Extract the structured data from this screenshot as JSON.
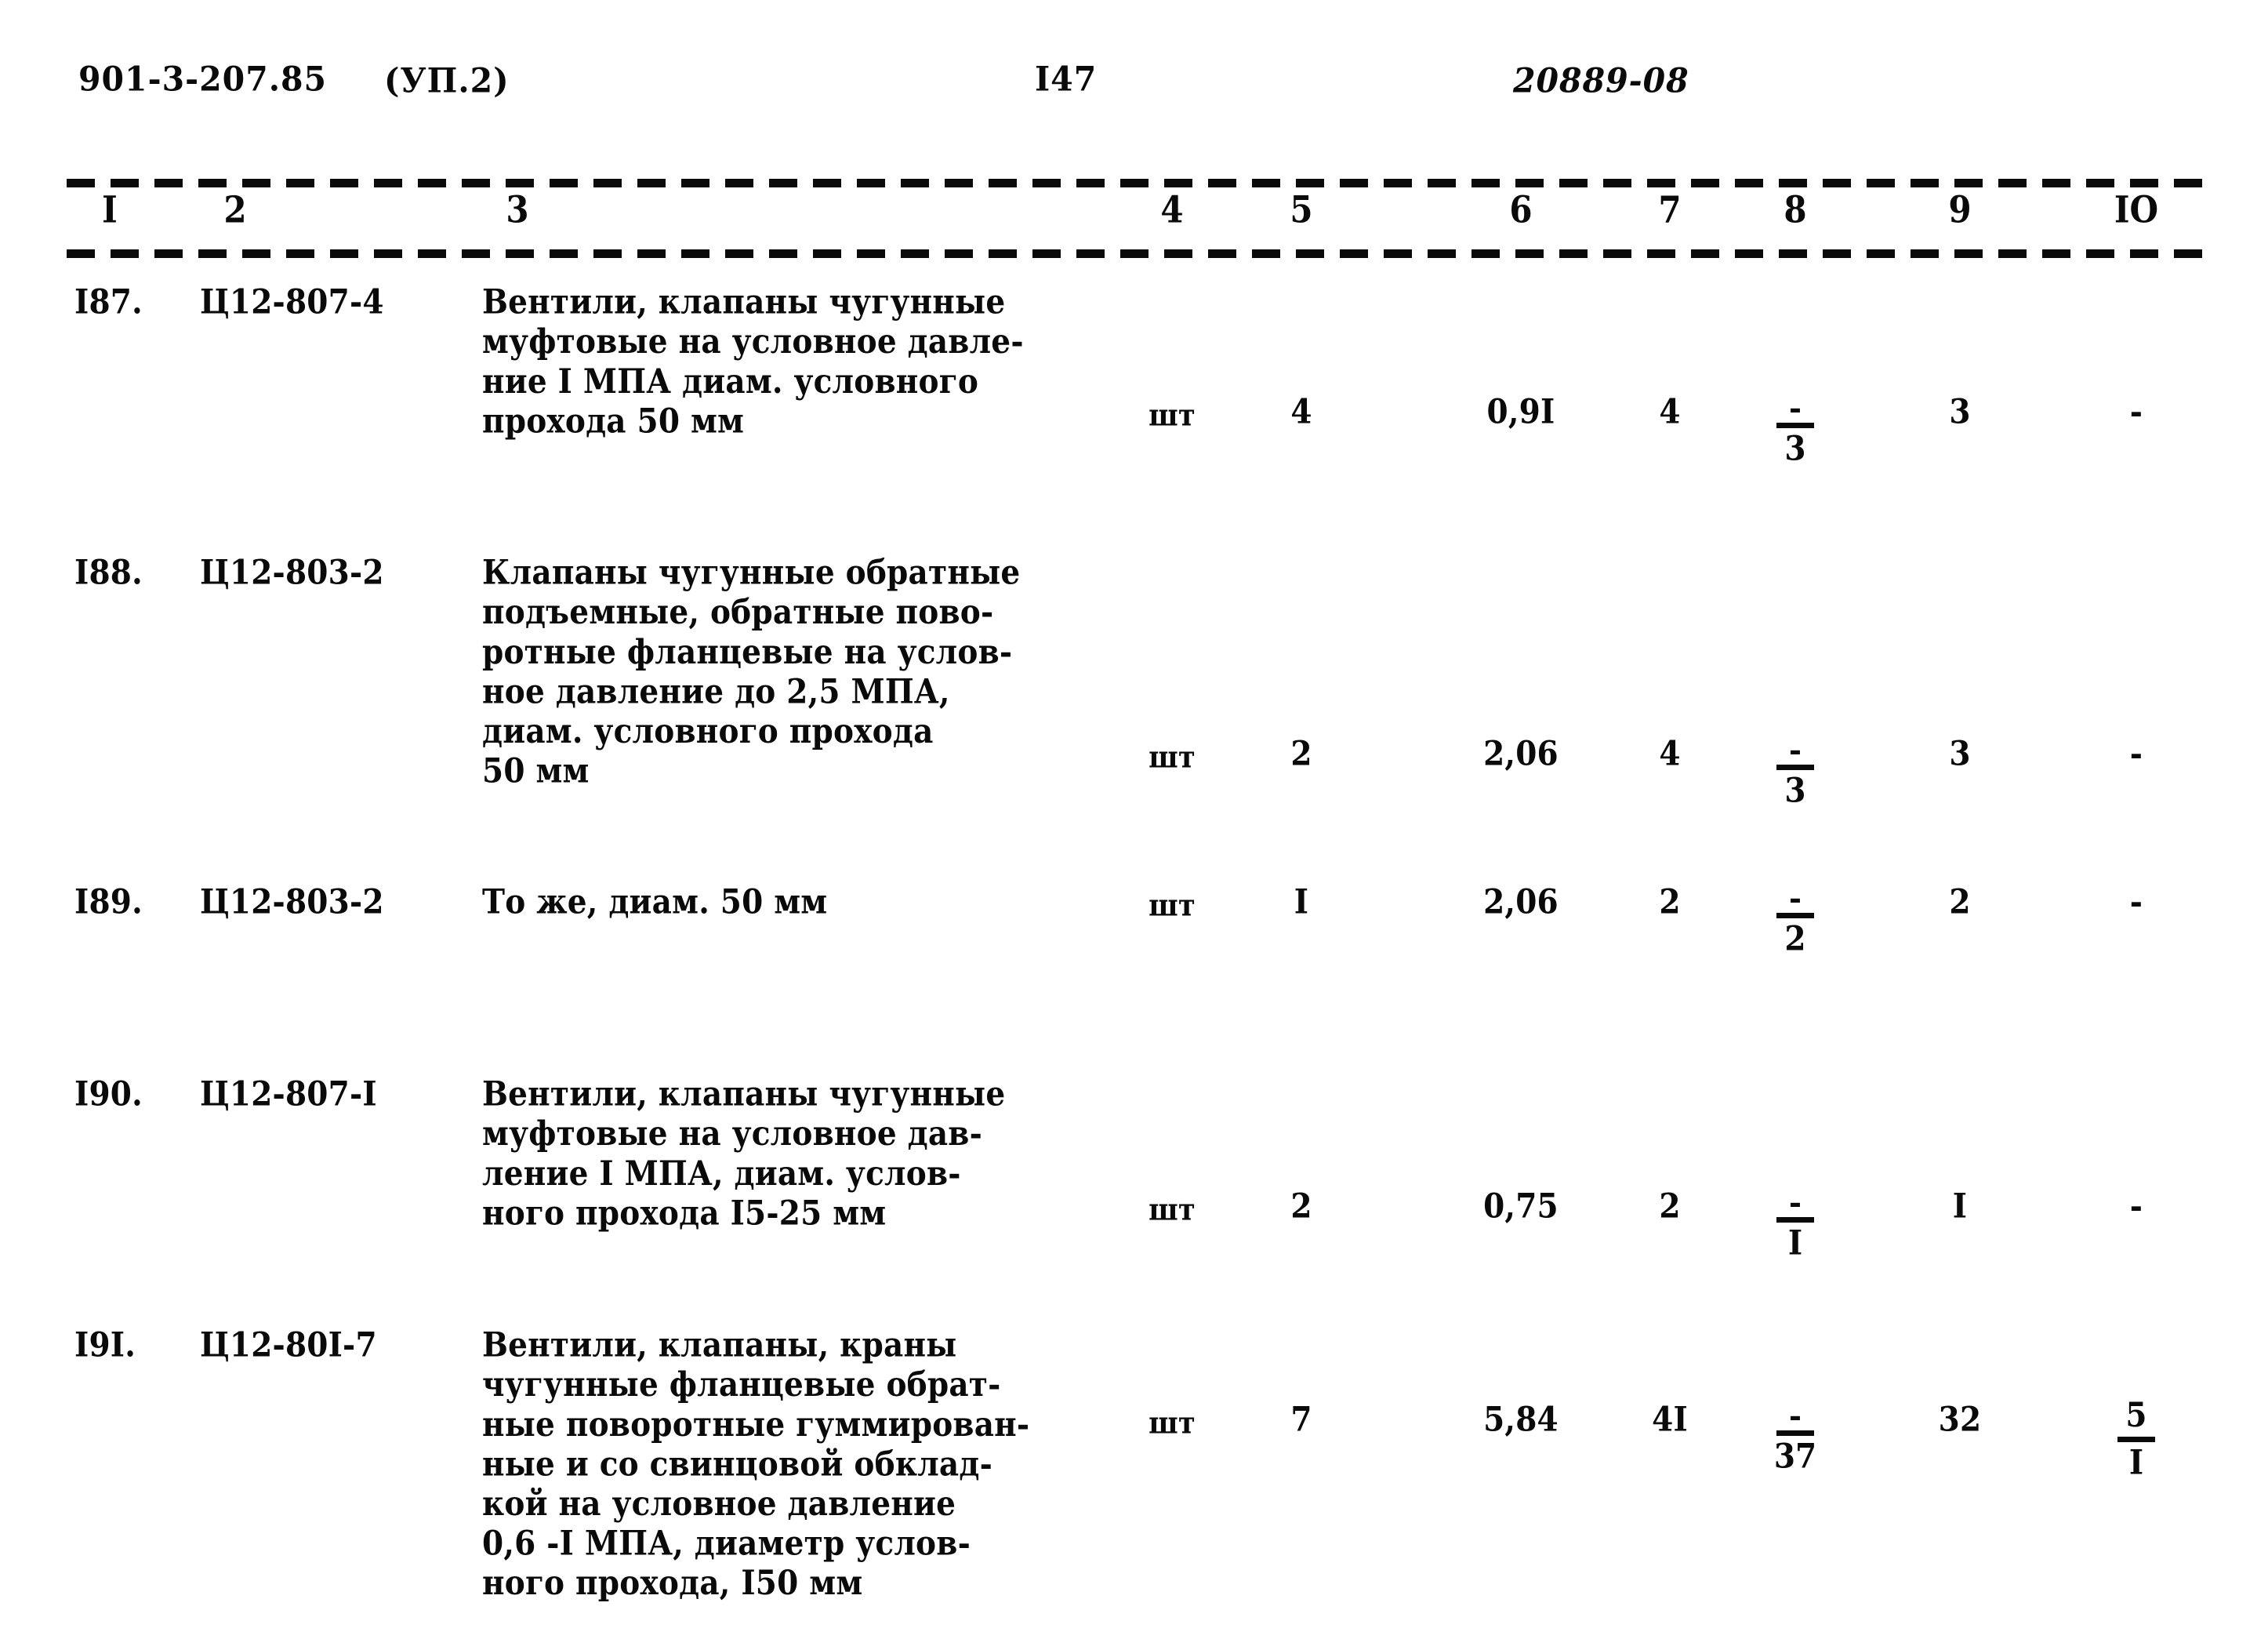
{
  "header": {
    "series_code": "901-3-207.85",
    "album": "(УП.2)",
    "page_number": "I47",
    "right_code": "20889-08"
  },
  "table": {
    "column_numbers": [
      "I",
      "2",
      "3",
      "4",
      "5",
      "6",
      "7",
      "8",
      "9",
      "IO"
    ],
    "rows": [
      {
        "num": "I87.",
        "code": "Ц12-807-4",
        "description": "Вентили, клапаны чугунные\nмуфтовые на условное давле-\nние I МПА диам. условного\nпрохода 50 мм",
        "unit": "шт",
        "col5": "4",
        "col6": "0,9I",
        "col7": "4",
        "col8_numerator": "-",
        "col8_denominator": "3",
        "col9": "3",
        "col10": "-"
      },
      {
        "num": "I88.",
        "code": "Ц12-803-2",
        "description": "Клапаны чугунные обратные\nподъемные, обратные пово-\nротные фланцевые на услов-\nное давление до 2,5 МПА,\nдиам. условного прохода\n50 мм",
        "unit": "шт",
        "col5": "2",
        "col6": "2,06",
        "col7": "4",
        "col8_numerator": "-",
        "col8_denominator": "3",
        "col9": "3",
        "col10": "-"
      },
      {
        "num": "I89.",
        "code": "Ц12-803-2",
        "description": "То же, диам. 50 мм",
        "unit": "шт",
        "col5": "I",
        "col6": "2,06",
        "col7": "2",
        "col8_numerator": "-",
        "col8_denominator": "2",
        "col9": "2",
        "col10": "-"
      },
      {
        "num": "I90.",
        "code": "Ц12-807-I",
        "description": "Вентили, клапаны чугунные\nмуфтовые на условное дав-\nление I МПА, диам. услов-\nного прохода I5-25 мм",
        "unit": "шт",
        "col5": "2",
        "col6": "0,75",
        "col7": "2",
        "col8_numerator": "-",
        "col8_denominator": "I",
        "col9": "I",
        "col10": "-"
      },
      {
        "num": "I9I.",
        "code": "Ц12-80I-7",
        "description": "Вентили, клапаны, краны\nчугунные фланцевые обрат-\nные поворотные гуммирован-\nные и со свинцовой обклад-\nкой на условное давление\n0,6 -I МПА, диаметр услов-\nного прохода, I50 мм",
        "unit": "шт",
        "col5": "7",
        "col6": "5,84",
        "col7": "4I",
        "col8_numerator": "-",
        "col8_denominator": "37",
        "col9": "32",
        "col10_numerator": "5",
        "col10_denominator": "I"
      }
    ]
  }
}
